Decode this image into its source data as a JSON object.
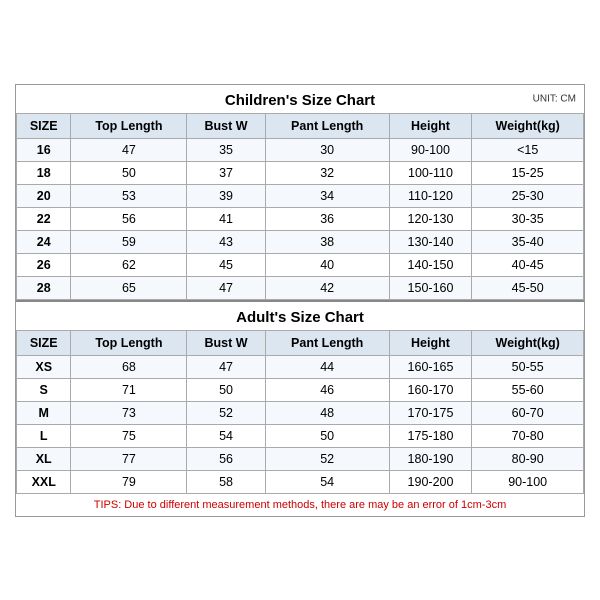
{
  "children_title": "Children's Size Chart",
  "adult_title": "Adult's Size Chart",
  "unit": "UNIT: CM",
  "tips": "TIPS: Due to different measurement methods, there are may be an error of 1cm-3cm",
  "columns": [
    "SIZE",
    "Top Length",
    "Bust W",
    "Pant Length",
    "Height",
    "Weight(kg)"
  ],
  "children_rows": [
    [
      "16",
      "47",
      "35",
      "30",
      "90-100",
      "<15"
    ],
    [
      "18",
      "50",
      "37",
      "32",
      "100-110",
      "15-25"
    ],
    [
      "20",
      "53",
      "39",
      "34",
      "110-120",
      "25-30"
    ],
    [
      "22",
      "56",
      "41",
      "36",
      "120-130",
      "30-35"
    ],
    [
      "24",
      "59",
      "43",
      "38",
      "130-140",
      "35-40"
    ],
    [
      "26",
      "62",
      "45",
      "40",
      "140-150",
      "40-45"
    ],
    [
      "28",
      "65",
      "47",
      "42",
      "150-160",
      "45-50"
    ]
  ],
  "adult_rows": [
    [
      "XS",
      "68",
      "47",
      "44",
      "160-165",
      "50-55"
    ],
    [
      "S",
      "71",
      "50",
      "46",
      "160-170",
      "55-60"
    ],
    [
      "M",
      "73",
      "52",
      "48",
      "170-175",
      "60-70"
    ],
    [
      "L",
      "75",
      "54",
      "50",
      "175-180",
      "70-80"
    ],
    [
      "XL",
      "77",
      "56",
      "52",
      "180-190",
      "80-90"
    ],
    [
      "XXL",
      "79",
      "58",
      "54",
      "190-200",
      "90-100"
    ]
  ]
}
